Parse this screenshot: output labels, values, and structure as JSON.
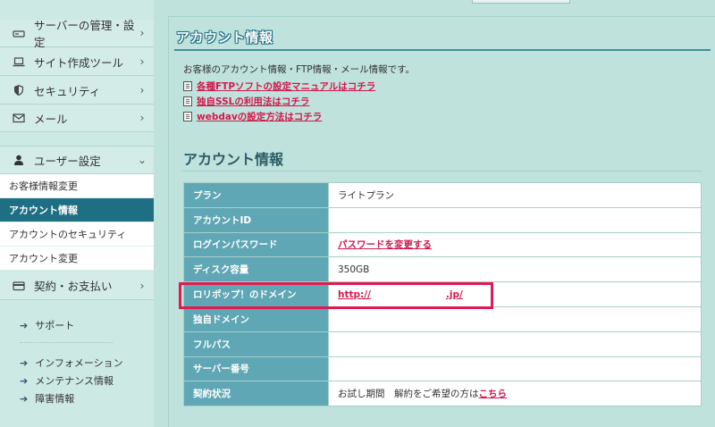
{
  "sidebar": {
    "main_items": [
      {
        "label": "サーバーの管理・設定",
        "icon": "server-icon",
        "chevron": "›"
      },
      {
        "label": "サイト作成ツール",
        "icon": "laptop-icon",
        "chevron": "›"
      },
      {
        "label": "セキュリティ",
        "icon": "shield-icon",
        "chevron": "›"
      },
      {
        "label": "メール",
        "icon": "mail-icon",
        "chevron": "›"
      },
      {
        "label": "ユーザー設定",
        "icon": "user-icon",
        "chevron": "⌄"
      }
    ],
    "user_sub_items": [
      {
        "label": "お客様情報変更",
        "active": false
      },
      {
        "label": "アカウント情報",
        "active": true
      },
      {
        "label": "アカウントのセキュリティ",
        "active": false
      },
      {
        "label": "アカウント変更",
        "active": false
      }
    ],
    "billing": {
      "label": "契約・お支払い",
      "icon": "credit-card-icon",
      "chevron": "›"
    },
    "links": [
      {
        "label": "サポート"
      },
      {
        "label": "インフォメーション"
      },
      {
        "label": "メンテナンス情報"
      },
      {
        "label": "障害情報"
      }
    ],
    "link_arrow": "➔"
  },
  "main": {
    "title": "アカウント情報",
    "intro": "お客様のアカウント情報・FTP情報・メール情報です。",
    "manual_links": [
      "各種FTPソフトの設定マニュアルはコチラ",
      "独自SSLの利用法はコチラ",
      "webdavの設定方法はコチラ"
    ],
    "section_title": "アカウント情報",
    "table": {
      "plan_label": "プラン",
      "plan_value": "ライトプラン",
      "account_id_label": "アカウントID",
      "account_id_value": "",
      "login_pw_label": "ログインパスワード",
      "login_pw_link": "パスワードを変更する",
      "disk_label": "ディスク容量",
      "disk_value": "350GB",
      "domain_label": "ロリポップ！のドメイン",
      "domain_prefix": "http://",
      "domain_suffix": ".jp/",
      "custom_domain_label": "独自ドメイン",
      "custom_domain_value": "",
      "fullpath_label": "フルパス",
      "fullpath_value": "",
      "server_no_label": "サーバー番号",
      "server_no_value": "",
      "contract_label": "契約状況",
      "contract_text": "お試し期間　解約をご希望の方は",
      "contract_link": "こちら"
    }
  },
  "colors": {
    "accent": "#1f6f84",
    "key_cell": "#5fa7b4",
    "link": "#d0194d",
    "highlight": "#e2194f",
    "background": "#bfe2dc"
  }
}
